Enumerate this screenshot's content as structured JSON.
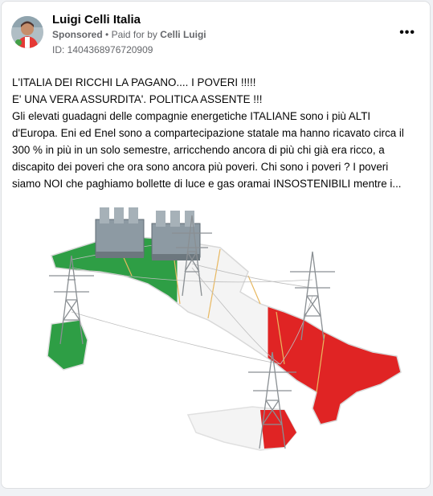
{
  "post": {
    "page_name": "Luigi Celli Italia",
    "sponsored_label": "Sponsored",
    "separator": "•",
    "paid_for_by_prefix": "Paid for by",
    "paid_for_by_name": "Celli Luigi",
    "ad_id": "ID: 1404368976720909",
    "more_label": "•••",
    "text_lines": [
      "L'ITALIA DEI RICCHI LA PAGANO.... I POVERI !!!!!",
      "E' UNA VERA ASSURDITA'. POLITICA ASSENTE !!!",
      "Gli elevati guadagni delle compagnie energetiche ITALIANE sono i più ALTI",
      "d'Europa. Eni ed Enel sono a compartecipazione statale ma hanno ricavato circa il",
      "300 % in più in un solo semestre, arricchendo ancora di più chi già era ricco, a",
      "discapito dei poveri che ora sono ancora più poveri. Chi sono i poveri ? I poveri",
      "siamo NOI che paghiamo bollette di luce e gas oramai INSOSTENIBILI mentre i..."
    ]
  },
  "colors": {
    "italy_green": "#2e9e45",
    "italy_white": "#f4f4f4",
    "italy_red": "#e02424",
    "text_primary": "#050505",
    "text_secondary": "#65676b"
  },
  "icons": {
    "more": "more-options-icon",
    "avatar": "profile-avatar",
    "image": "italy-power-grid-illustration"
  }
}
